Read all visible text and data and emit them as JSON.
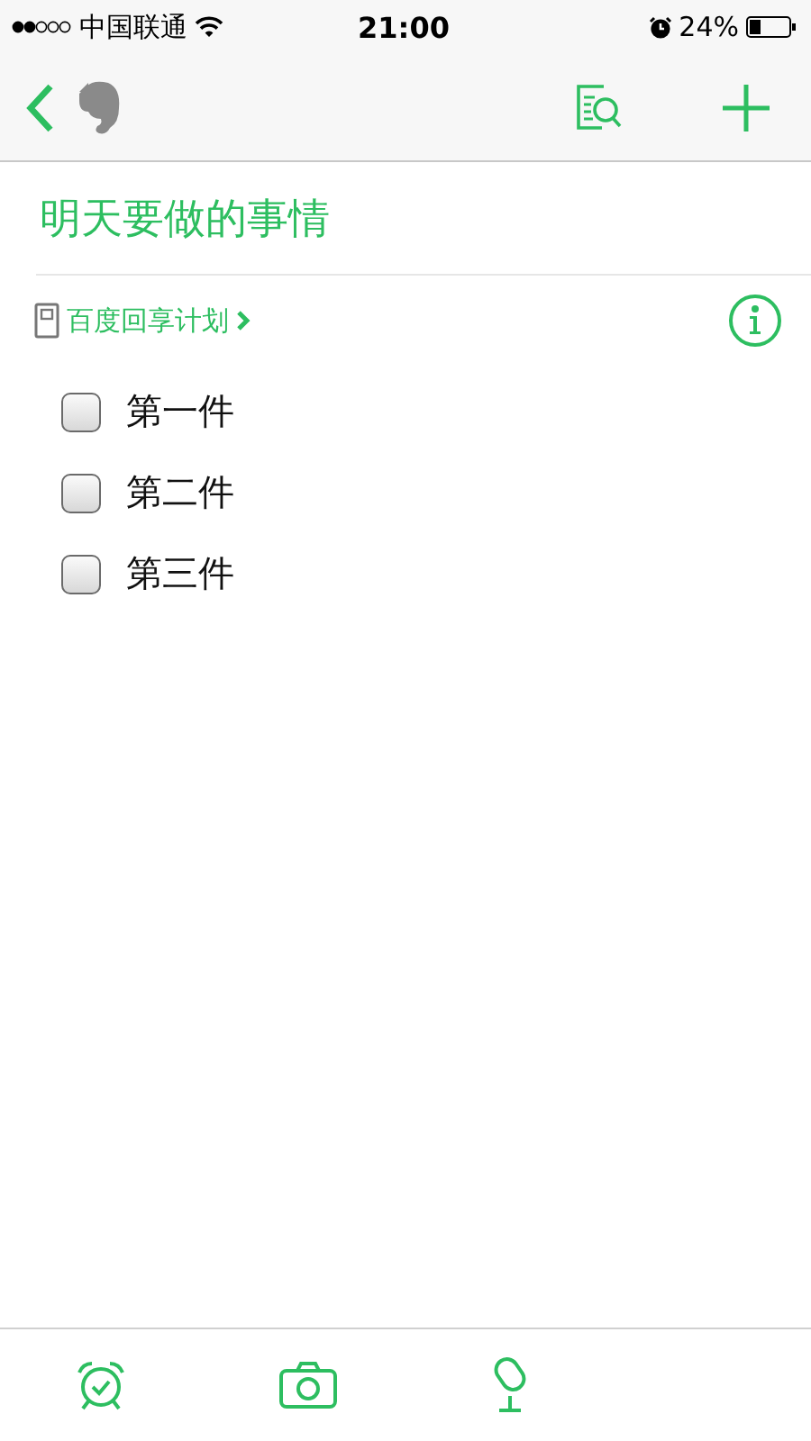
{
  "status_bar": {
    "carrier": "中国联通",
    "time": "21:00",
    "battery": "24%"
  },
  "note": {
    "title": "明天要做的事情",
    "notebook": "百度回享计划",
    "checklist": [
      {
        "text": "第一件",
        "checked": false
      },
      {
        "text": "第二件",
        "checked": false
      },
      {
        "text": "第三件",
        "checked": false
      }
    ]
  }
}
